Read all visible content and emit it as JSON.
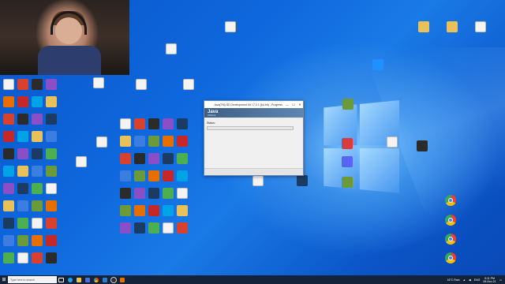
{
  "desktop": {
    "top_right_icons": [
      {
        "name": "folder-icon",
        "label": "",
        "color": "#e8c15a"
      },
      {
        "name": "java-file-icon",
        "label": "",
        "color": "#f4f4f4"
      },
      {
        "name": "java-file-icon",
        "label": "",
        "color": "#f4f4f4"
      }
    ],
    "scattered_icons": [
      {
        "name": "java-file-icon",
        "label": "",
        "color": "#f4f4f4"
      },
      {
        "name": "cube-app-icon",
        "label": "",
        "color": "#5f8a3a"
      },
      {
        "name": "chat-app-icon",
        "label": "",
        "color": "#1e90ff"
      },
      {
        "name": "minecraft-icon",
        "label": "",
        "color": "#6a9a3a"
      },
      {
        "name": "rocket-icon",
        "label": "",
        "color": "#d83c3c"
      },
      {
        "name": "java-file-icon",
        "label": "",
        "color": "#f4f4f4"
      },
      {
        "name": "discord-icon",
        "label": "",
        "color": "#5865f2"
      },
      {
        "name": "minecraft-icon",
        "label": "",
        "color": "#6a9a3a"
      },
      {
        "name": "command-block-icon",
        "label": "",
        "color": "#2b2b2b"
      },
      {
        "name": "java-file-icon",
        "label": "",
        "color": "#f4f4f4"
      },
      {
        "name": "steam-icon",
        "label": "",
        "color": "#1b3b63"
      }
    ],
    "right_chrome_icons": [
      {
        "name": "chrome-icon",
        "label": ""
      },
      {
        "name": "chrome-icon",
        "label": ""
      },
      {
        "name": "chrome-icon",
        "label": ""
      },
      {
        "name": "chrome-icon",
        "label": ""
      }
    ]
  },
  "dialog": {
    "title": "Java(TM) SE Development Kit 17.0.1 (64-bit) - Progress",
    "banner_logo": "Java",
    "banner_sub": "ORACLE",
    "status_label": "Status:",
    "progress": 0.0,
    "close_glyph": "✕",
    "min_glyph": "—",
    "max_glyph": "☐"
  },
  "taskbar": {
    "search_placeholder": "Type here to search",
    "weather": "16°C  Rain",
    "time": "9:11 PM",
    "date": "05-Nov-21",
    "lang": "ENG"
  },
  "colors": {
    "accent": "#0b5fd6",
    "taskbar": "#15233a",
    "progress": "#06b025"
  }
}
